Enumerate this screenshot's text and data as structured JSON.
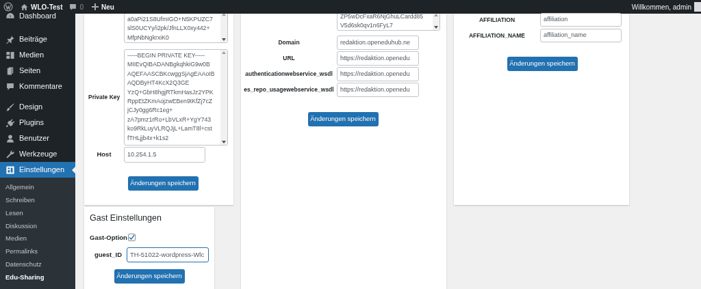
{
  "admin_bar": {
    "site": "WLO-Test",
    "comments": "0",
    "new": "Neu",
    "greeting": "Willkommen, admin"
  },
  "sidebar": {
    "items": [
      {
        "label": "Dashboard",
        "kind": "dashboard",
        "selected": false
      },
      {
        "label": "Beiträge",
        "kind": "pin",
        "selected": false
      },
      {
        "label": "Medien",
        "kind": "media",
        "selected": false
      },
      {
        "label": "Seiten",
        "kind": "pages",
        "selected": false
      },
      {
        "label": "Kommentare",
        "kind": "comment",
        "selected": false
      },
      {
        "label": "Design",
        "kind": "brush",
        "selected": false
      },
      {
        "label": "Plugins",
        "kind": "plug",
        "selected": false
      },
      {
        "label": "Benutzer",
        "kind": "user",
        "selected": false
      },
      {
        "label": "Werkzeuge",
        "kind": "wrench",
        "selected": false
      },
      {
        "label": "Einstellungen",
        "kind": "settings",
        "selected": true
      }
    ],
    "submenu": [
      {
        "label": "Allgemein",
        "selected": false
      },
      {
        "label": "Schreiben",
        "selected": false
      },
      {
        "label": "Lesen",
        "selected": false
      },
      {
        "label": "Diskussion",
        "selected": false
      },
      {
        "label": "Medien",
        "selected": false
      },
      {
        "label": "Permalinks",
        "selected": false
      },
      {
        "label": "Datenschutz",
        "selected": false
      },
      {
        "label": "Edu-Sharing",
        "selected": true
      }
    ]
  },
  "key_card": {
    "public_key_lines": [
      "a0aPi21S8UfmIGO+N5KPUZC7",
      "slS0UCYy/i2pk/JfnLLX0xy442+",
      "MfpNbNgkrxiK0"
    ],
    "private_key": {
      "label": "Private Key",
      "lines": [
        "-----BEGIN PRIVATE KEY-----",
        "MIIEvQIBADANBgkqhkiG9w0B",
        "AQEFAASCBKcwggSjAgEAAoIB",
        "AQDByHT4KcX2Q3GE",
        "YzQ+GbH8hgjRTkmHasJz2YPK",
        "RppEtZKmAojzwEBen9tKfZj7cZ",
        "jCJy0gg6Rc1eg+",
        "zA7pmz1rRo+LbVLxR+YgY743",
        "ko9RkLuyVLRQJjL+LamT8l+cst",
        "fTHLjjb4x+k1s2"
      ]
    },
    "host": {
      "label": "Host",
      "value": "10.254.1.5"
    },
    "save": "Änderungen speichern"
  },
  "repo_card": {
    "textarea_lines": [
      "ZP5wDcFxaR6NjGhuLCardd85",
      "V5d6sk0qv1n6FyL7"
    ],
    "fields": [
      {
        "label": "Domain",
        "value": "redaktion.openeduhub.ne"
      },
      {
        "label": "URL",
        "value": "https://redaktion.openedu"
      },
      {
        "label": "authenticationwebservice_wsdl",
        "value": "https://redaktion.openedu"
      },
      {
        "label": "es_repo_usagewebservice_wsdl",
        "value": "https://redaktion.openedu"
      }
    ],
    "save": "Änderungen speichern"
  },
  "affiliation_card": {
    "fields": [
      {
        "label": "AFFILIATION",
        "value": "affiliation"
      },
      {
        "label": "AFFILIATION_NAME",
        "value": "affiliation_name"
      }
    ],
    "save": "Änderungen speichern"
  },
  "guest_card": {
    "title": "Gast Einstellungen",
    "option": {
      "label": "Gast-Option",
      "checked": true
    },
    "guest_id": {
      "label": "guest_ID",
      "value": "TH-51022-wordpress-Wlc",
      "focused": true
    },
    "save": "Änderungen speichern"
  }
}
